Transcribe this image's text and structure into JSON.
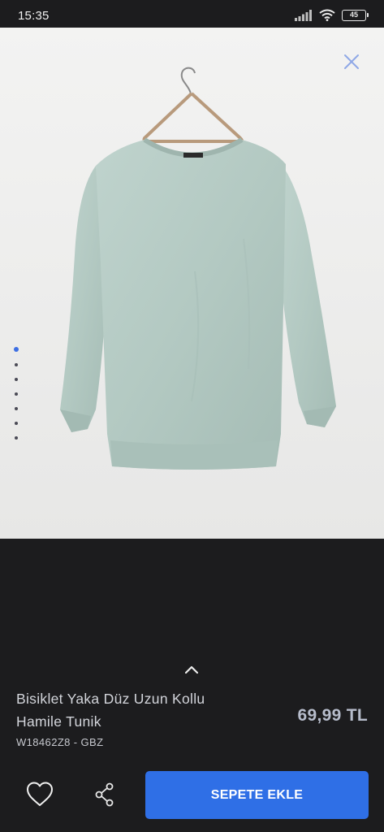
{
  "status_bar": {
    "time": "15:35",
    "battery": "45",
    "icons": [
      "signal-icon",
      "wifi-icon",
      "battery-icon"
    ]
  },
  "gallery": {
    "image_description_icon": "product-photo",
    "page_count": 7,
    "active_page": 1,
    "close_icon": "close-icon"
  },
  "product": {
    "title_line1": "Bisiklet Yaka Düz Uzun Kollu",
    "title_line2": "Hamile Tunik",
    "price": "69,99 TL",
    "sku": "W18462Z8 - GBZ"
  },
  "actions": {
    "add_to_cart_label": "SEPETE EKLE",
    "favorite_icon": "heart-icon",
    "share_icon": "share-icon",
    "expand_icon": "chevron-up-icon"
  },
  "colors": {
    "background": "#1c1c1e",
    "accent": "#2f6fe6",
    "product_color": "#b5cbc5"
  }
}
